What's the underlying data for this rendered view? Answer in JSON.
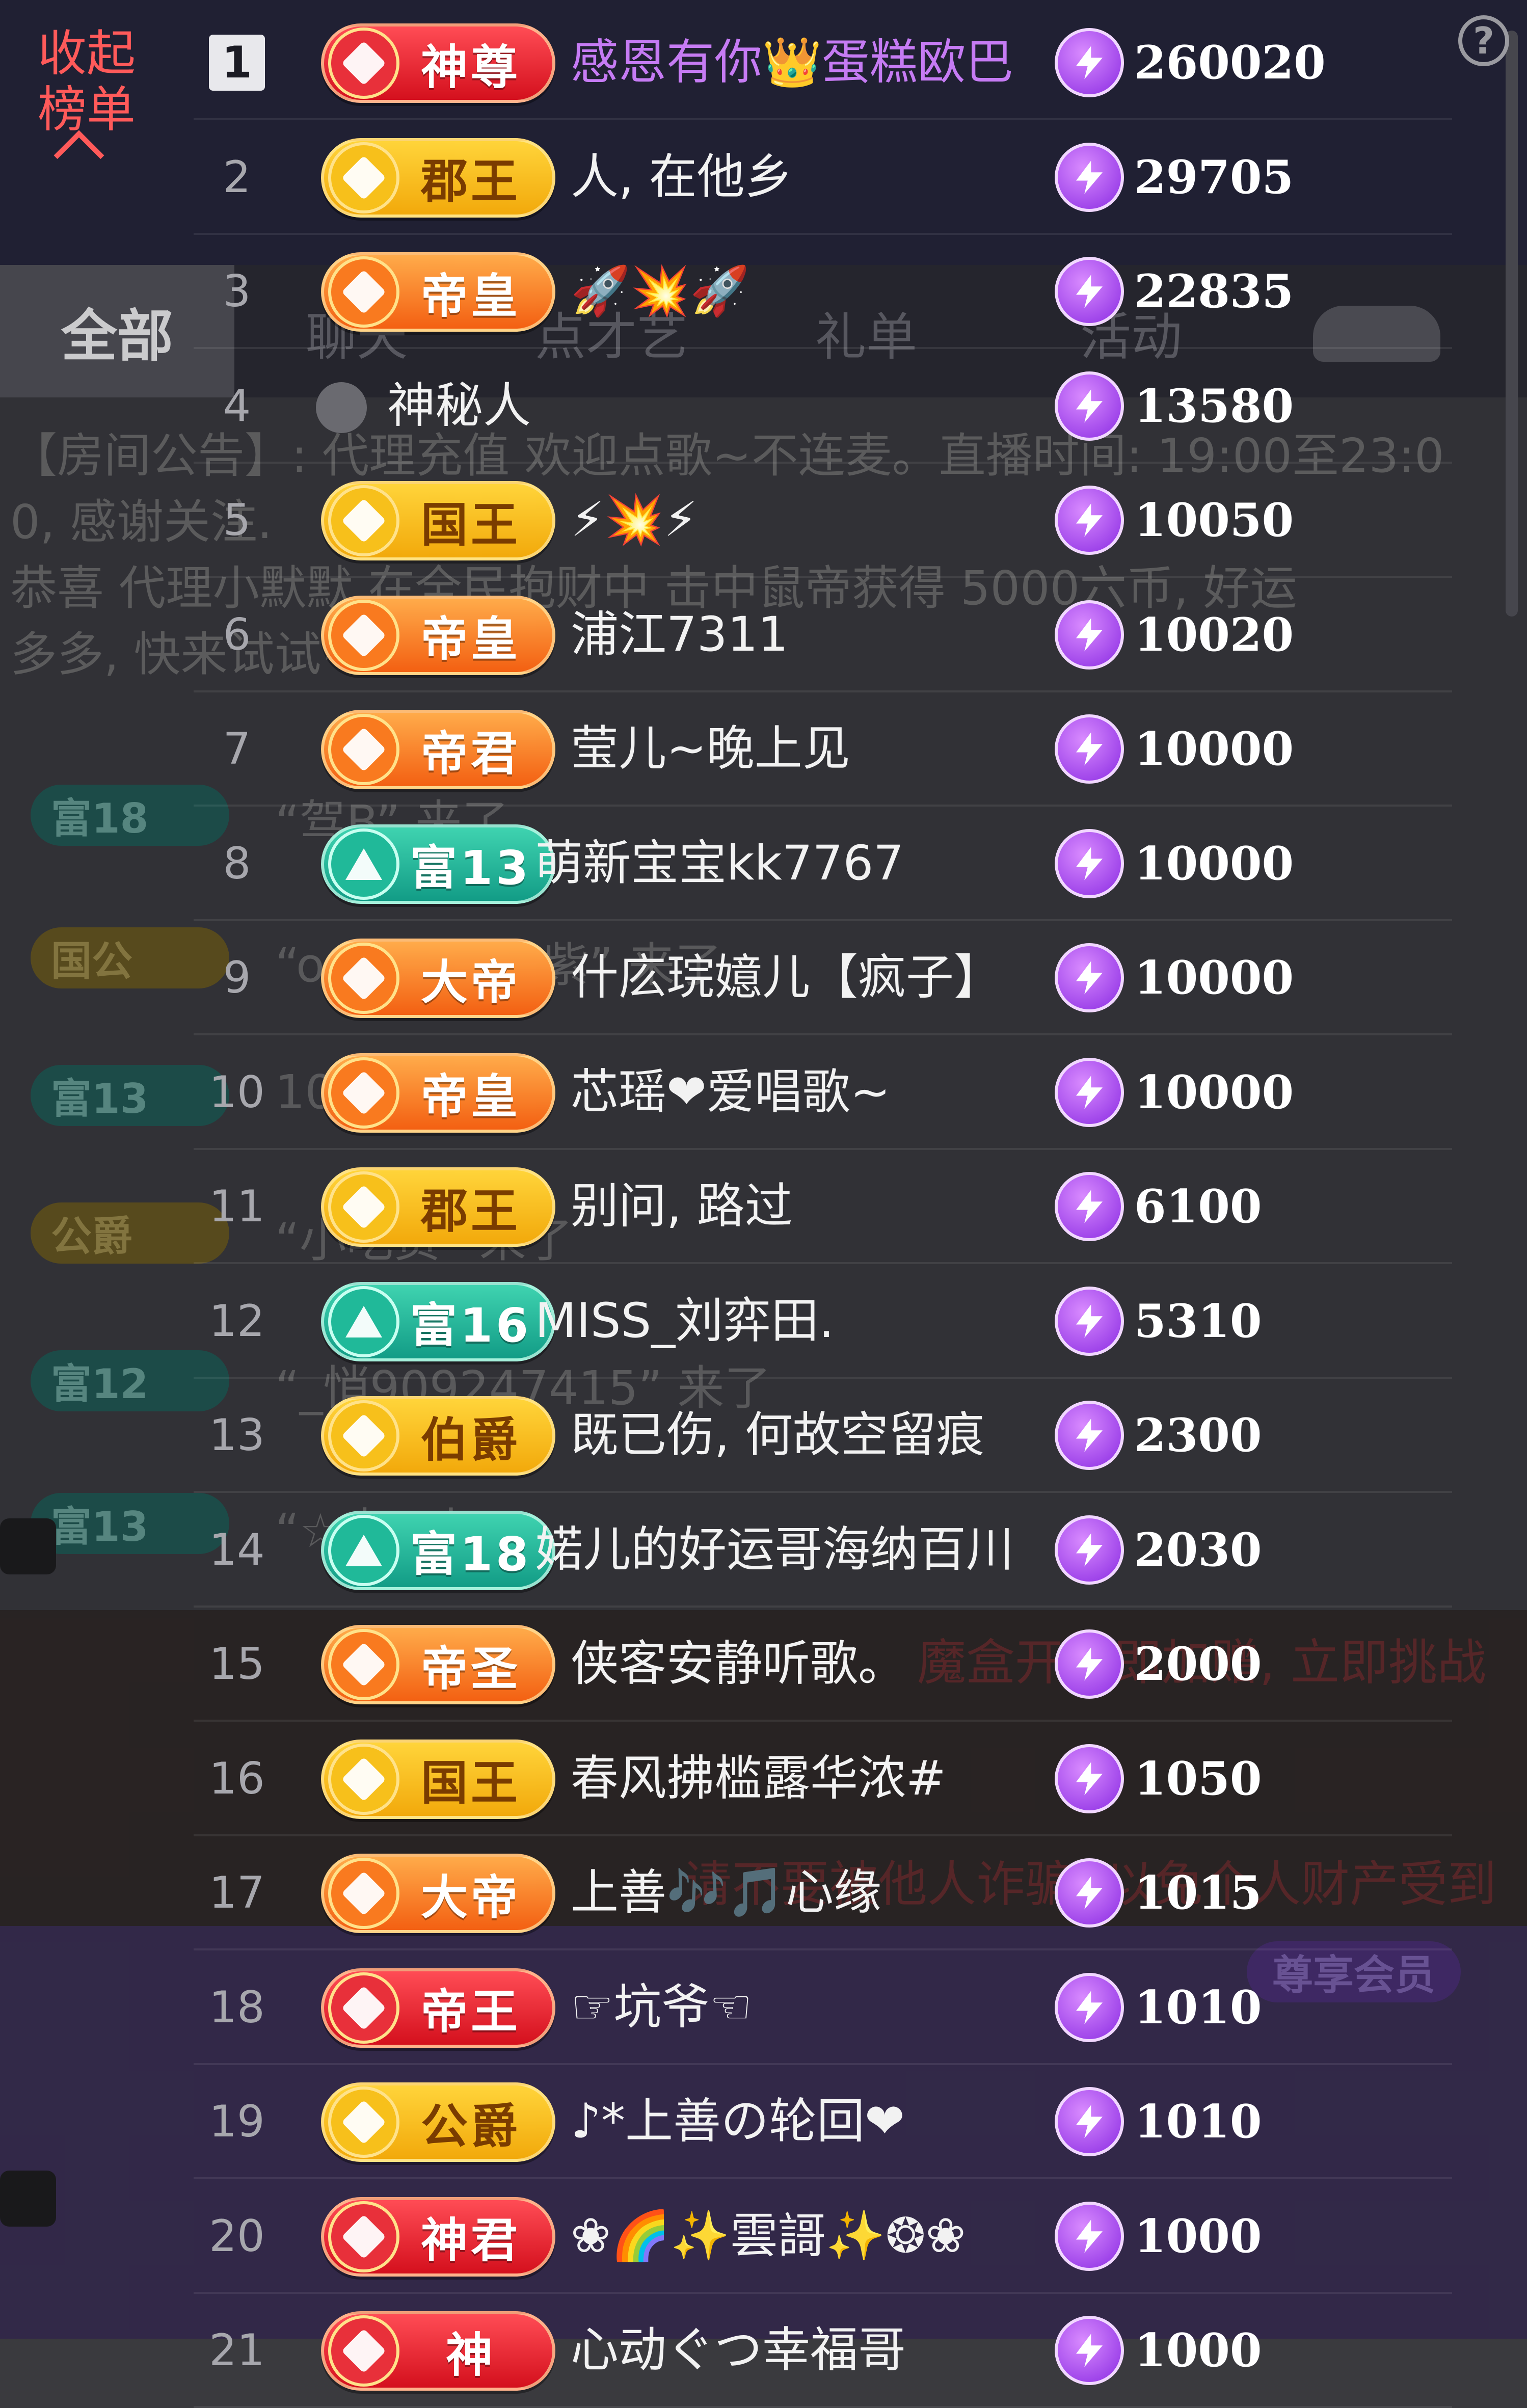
{
  "panel": {
    "collapse_label": "收起榜单",
    "help_label": "?"
  },
  "background": {
    "tab_active": "全部",
    "tabs": [
      "聊天",
      "点才艺",
      "礼单",
      "活动"
    ],
    "notice_lines": [
      "【房间公告】: 代理充值 欢迎点歌~不连麦。直播时间: 19:00至23:0",
      "0, 感谢关注.",
      "恭喜 代理小默默 在全民抱财中 击中鼠帝获得 5000六币, 好运",
      "多多, 快来试试~"
    ],
    "chat": [
      {
        "badge": "富18",
        "text": "“驾B” 来了"
      },
      {
        "badge": "国公",
        "text": "“o 混臻 暮容紫” 来了"
      },
      {
        "badge": "富13",
        "text": "10"
      },
      {
        "badge": "公爵",
        "text": "“小吃货” 来了"
      },
      {
        "badge": "富12",
        "text": "“_悄909247415” 来了"
      },
      {
        "badge": "富13",
        "text": "“☆森” 来了"
      }
    ],
    "promo": "魔盒开启即加赠, 立即挑战",
    "warn": "请不要被他人诈骗, 以免个人财产受到",
    "vip": "尊享会员"
  },
  "rows": [
    {
      "rank": "1",
      "badge": "神尊",
      "badge_style": "red",
      "name": "感恩有你👑蛋糕欧巴",
      "name_style": "pink",
      "score": "260020"
    },
    {
      "rank": "2",
      "badge": "郡王",
      "badge_style": "gold",
      "name": "人, 在他乡",
      "name_style": "",
      "score": "29705"
    },
    {
      "rank": "3",
      "badge": "帝皇",
      "badge_style": "orange",
      "name": "🚀💥🚀",
      "name_style": "",
      "score": "22835"
    },
    {
      "rank": "4",
      "badge": "",
      "badge_style": "none",
      "name": "神秘人",
      "name_style": "",
      "score": "13580"
    },
    {
      "rank": "5",
      "badge": "国王",
      "badge_style": "gold",
      "name": "⚡💥⚡",
      "name_style": "",
      "score": "10050"
    },
    {
      "rank": "6",
      "badge": "帝皇",
      "badge_style": "orange",
      "name": "浦江7311",
      "name_style": "",
      "score": "10020"
    },
    {
      "rank": "7",
      "badge": "帝君",
      "badge_style": "orange",
      "name": "莹儿~晚上见",
      "name_style": "",
      "score": "10000"
    },
    {
      "rank": "8",
      "badge": "富13",
      "badge_style": "teal",
      "name": "萌新宝宝kk7767",
      "name_style": "",
      "score": "10000"
    },
    {
      "rank": "9",
      "badge": "大帝",
      "badge_style": "orange",
      "name": "什庅琓嬑儿【疯子】",
      "name_style": "",
      "score": "10000"
    },
    {
      "rank": "10",
      "badge": "帝皇",
      "badge_style": "orange",
      "name": "芯瑶❤爱唱歌~",
      "name_style": "",
      "score": "10000"
    },
    {
      "rank": "11",
      "badge": "郡王",
      "badge_style": "gold",
      "name": "别问, 路过",
      "name_style": "",
      "score": "6100"
    },
    {
      "rank": "12",
      "badge": "富16",
      "badge_style": "teal",
      "name": "MISS_刘弈田.",
      "name_style": "",
      "score": "5310"
    },
    {
      "rank": "13",
      "badge": "伯爵",
      "badge_style": "gold",
      "name": "既已伤, 何故空留痕",
      "name_style": "",
      "score": "2300"
    },
    {
      "rank": "14",
      "badge": "富18",
      "badge_style": "teal",
      "name": "婼儿的好运哥海纳百川",
      "name_style": "",
      "score": "2030"
    },
    {
      "rank": "15",
      "badge": "帝圣",
      "badge_style": "orange",
      "name": "侠客安静听歌。",
      "name_style": "",
      "score": "2000"
    },
    {
      "rank": "16",
      "badge": "国王",
      "badge_style": "gold",
      "name": "春风拂槛露华浓#",
      "name_style": "",
      "score": "1050"
    },
    {
      "rank": "17",
      "badge": "大帝",
      "badge_style": "orange",
      "name": "上善🎶🎵心缘",
      "name_style": "",
      "score": "1015"
    },
    {
      "rank": "18",
      "badge": "帝王",
      "badge_style": "red",
      "name": "☞坑爷☜",
      "name_style": "",
      "score": "1010"
    },
    {
      "rank": "19",
      "badge": "公爵",
      "badge_style": "gold",
      "name": "♪*上善の轮回❤",
      "name_style": "",
      "score": "1010"
    },
    {
      "rank": "20",
      "badge": "神君",
      "badge_style": "red",
      "name": "❀🌈✨雲謌✨❂❀",
      "name_style": "",
      "score": "1000"
    },
    {
      "rank": "21",
      "badge": "神",
      "badge_style": "red",
      "name": "心动ぐつ幸福哥",
      "name_style": "",
      "score": "1000"
    }
  ],
  "colors": {
    "accent_red": "#ff5a5a",
    "name_pink": "#c67bf4",
    "bolt_purple": "#8a2be2"
  },
  "icons": {
    "score": "lightning-coin-icon",
    "help": "question-icon",
    "collapse": "chevron-up-icon",
    "mystery": "spy-avatar-icon"
  }
}
